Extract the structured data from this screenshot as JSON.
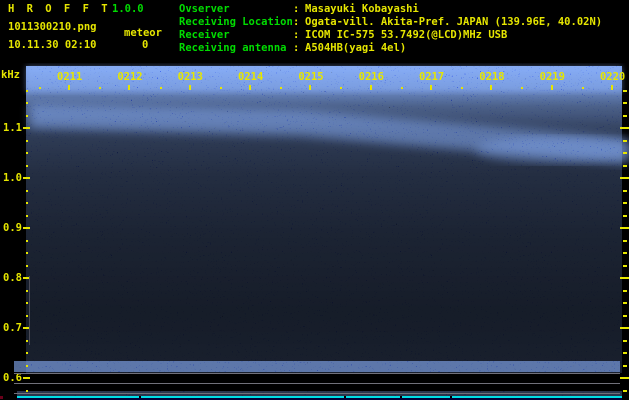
{
  "app": {
    "title": "H R O F F T",
    "version": "1.0.0",
    "filename": "1011300210.png",
    "mode": "meteor",
    "datetime": "10.11.30 02:10",
    "count": "0"
  },
  "info": {
    "rows": [
      {
        "label": "Ovserver",
        "sep": ":",
        "value": "Masayuki Kobayashi"
      },
      {
        "label": "Receiving Location",
        "sep": ":",
        "value": "Ogata-vill. Akita-Pref. JAPAN (139.96E, 40.02N)"
      },
      {
        "label": "Receiver",
        "sep": ":",
        "value": "ICOM IC-575 53.7492(@LCD)MHz USB"
      },
      {
        "label": "Receiving antenna",
        "sep": ":",
        "value": "A504HB(yagi 4el)"
      }
    ]
  },
  "axes": {
    "freq_unit": "kHz",
    "time_labels": [
      "0211",
      "0212",
      "0213",
      "0214",
      "0215",
      "0216",
      "0217",
      "0218",
      "0219",
      "0220"
    ],
    "freq_labels": [
      "1.1",
      "1.0",
      "0.9",
      "0.8",
      "0.7",
      "0.6"
    ]
  },
  "spectrogram": {
    "description": "dark-blue noise field; brighter echo band drifting from ~1.12 kHz at left to ~1.05 kHz at right; signal-level strip at bottom",
    "signal_bar_break_positions": [
      139,
      344,
      400,
      450
    ]
  },
  "colors": {
    "background": "#000000",
    "label_yellow": "#e6e600",
    "label_green": "#00dc00",
    "noise_blue": "#2233ff",
    "grid_gray": "#70707a",
    "bar_cyan": "#00dde6",
    "bar_fill": "#000038"
  }
}
